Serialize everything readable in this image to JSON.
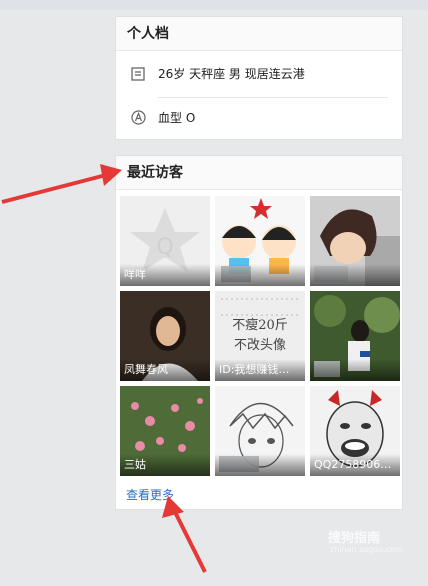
{
  "profile": {
    "title": "个人档",
    "info": "26岁  天秤座 男 现居连云港",
    "blood": "血型 O"
  },
  "visitors": {
    "title": "最近访客",
    "items": [
      {
        "name": "咩咩"
      },
      {
        "name": ""
      },
      {
        "name": ""
      },
      {
        "name": "凤舞春风"
      },
      {
        "name": "ID:我想赚钱…"
      },
      {
        "name": ""
      },
      {
        "name": "三姑"
      },
      {
        "name": ""
      },
      {
        "name": "QQ2758906…"
      }
    ],
    "more": "查看更多"
  },
  "watermark": {
    "text": "搜狗指南",
    "sub": "zhinan.sogou.com"
  },
  "poster_text": {
    "line1": "不瘦20斤",
    "line2": "不改头像"
  },
  "colors": {
    "arrow": "#e53935",
    "link": "#2a6fbe"
  }
}
